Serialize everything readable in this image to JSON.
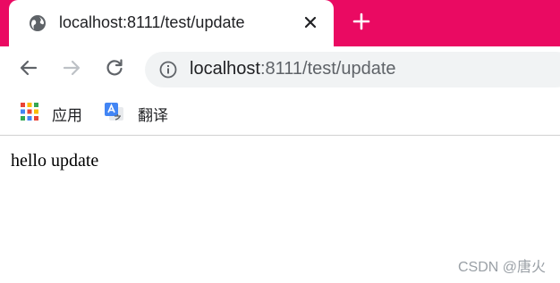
{
  "tab": {
    "title": "localhost:8111/test/update",
    "favicon": "globe-icon",
    "close": "close-icon"
  },
  "new_tab": {
    "icon": "plus-icon"
  },
  "toolbar": {
    "back": "arrow-left-icon",
    "forward": "arrow-right-icon",
    "reload": "reload-icon",
    "url_host": "localhost",
    "url_path": ":8111/test/update",
    "info_icon": "info-icon"
  },
  "bookmarks": [
    {
      "label": "应用",
      "icon": "apps-grid-icon"
    },
    {
      "label": "翻译",
      "icon": "google-translate-icon"
    }
  ],
  "page": {
    "text": "hello update"
  },
  "watermark": "CSDN @唐火",
  "colors": {
    "tabstrip": "#ea0a62",
    "omnibox": "#f1f3f4"
  }
}
